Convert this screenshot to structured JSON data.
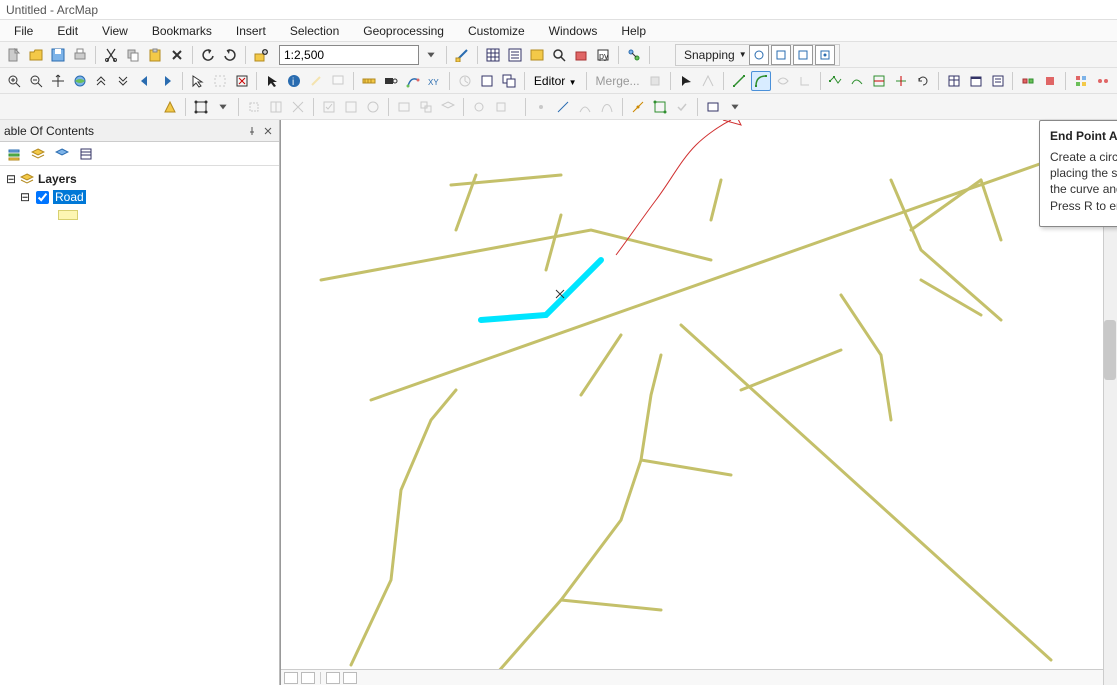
{
  "title": "Untitled - ArcMap",
  "menu": [
    "File",
    "Edit",
    "View",
    "Bookmarks",
    "Insert",
    "Selection",
    "Geoprocessing",
    "Customize",
    "Windows",
    "Help"
  ],
  "scale": "1:2,500",
  "snapping_label": "Snapping",
  "editor_label": "Editor",
  "editor_disabled": "Merge...",
  "toc": {
    "title": "able Of Contents",
    "root": "Layers",
    "layer": "Road",
    "layer_checked": true
  },
  "tooltip": {
    "title": "End Point Arc Segment",
    "body": "Create a circular arc segment by placing the start and end points of the curve and defining a radius. Press R to enter a radius."
  }
}
